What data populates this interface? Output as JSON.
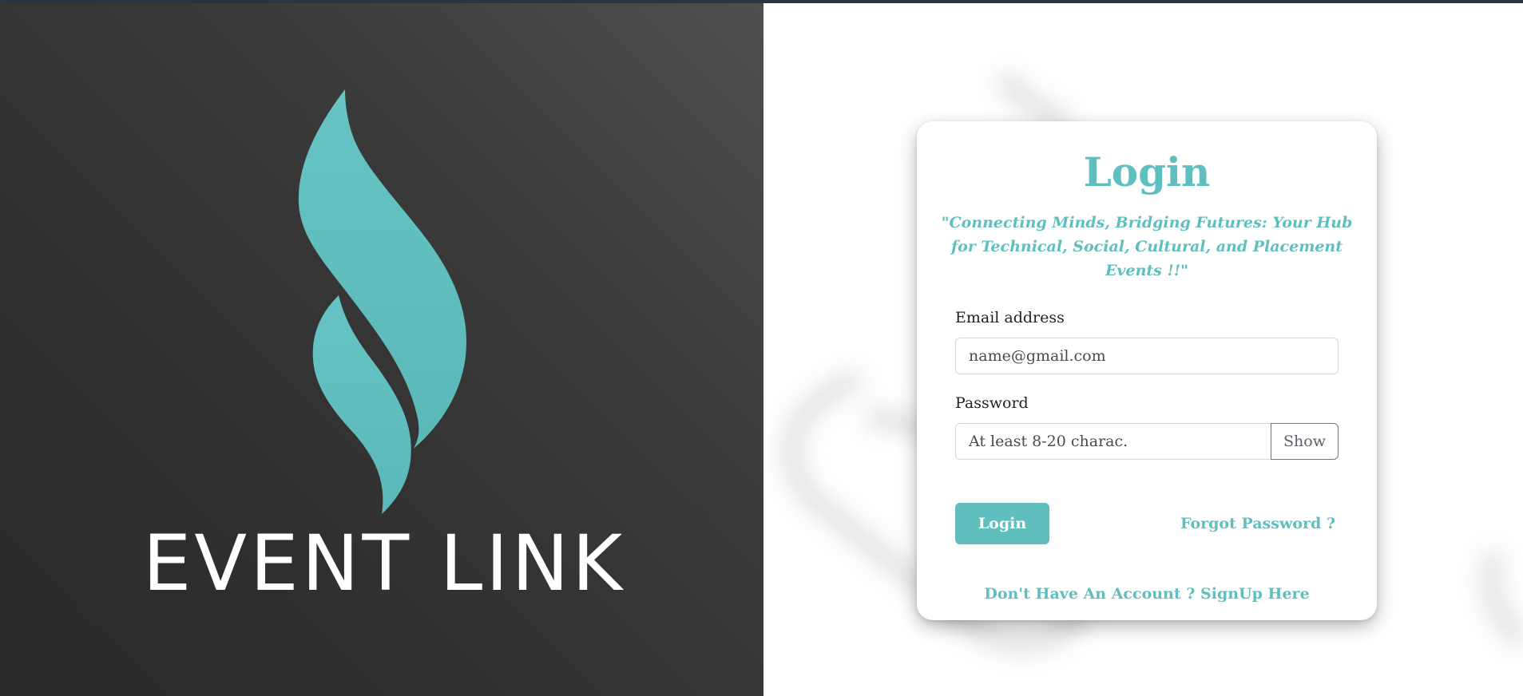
{
  "brand": {
    "name": "EVENT LINK",
    "accent_color": "#5fbfbf",
    "logo_icon": "flame-icon"
  },
  "login_card": {
    "title": "Login",
    "tagline": "\"Connecting Minds, Bridging Futures: Your Hub for Technical, Social, Cultural, and Placement Events !!\"",
    "email": {
      "label": "Email address",
      "placeholder": "name@gmail.com",
      "value": ""
    },
    "password": {
      "label": "Password",
      "placeholder": "At least 8-20 charac.",
      "value": "",
      "toggle_label": "Show"
    },
    "submit_label": "Login",
    "forgot_link": "Forgot Password ?",
    "signup_link": "Don't Have An Account ? SignUp Here"
  }
}
